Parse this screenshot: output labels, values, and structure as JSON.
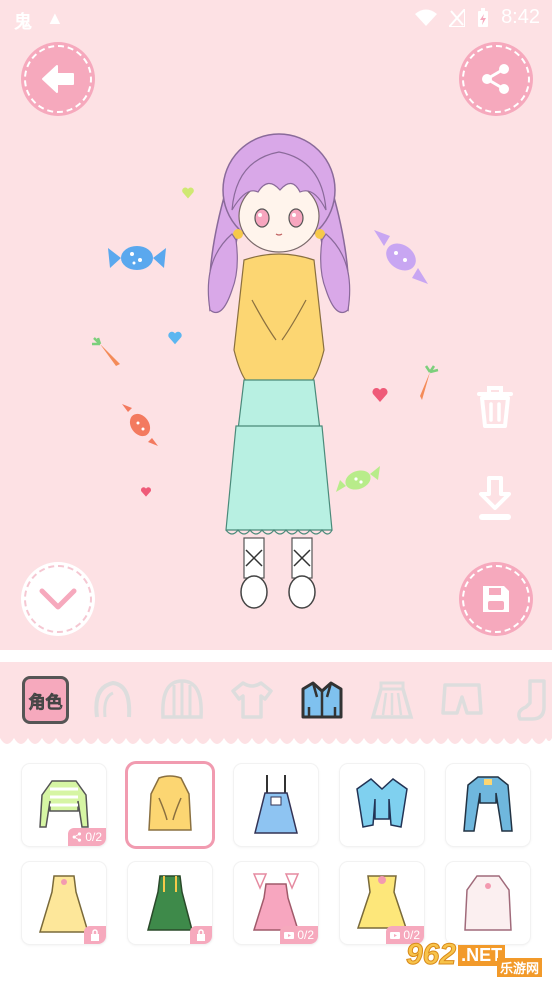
{
  "status_bar": {
    "time": "8:42",
    "left_glyphs": [
      "鬼",
      "▲"
    ]
  },
  "toolbar": {
    "back_icon": "arrow-left-icon",
    "share_icon": "share-icon",
    "delete_icon": "trash-icon",
    "download_icon": "download-icon",
    "collapse_icon": "chevron-down-icon",
    "save_icon": "floppy-disk-icon"
  },
  "categories": {
    "role_label": "角色",
    "items": [
      "hair-back",
      "hair-front",
      "shirt",
      "jacket",
      "skirt",
      "shorts",
      "socks"
    ],
    "selected": "jacket"
  },
  "items": [
    {
      "name": "striped-crop-top",
      "badge": "0/2",
      "badge_type": "share"
    },
    {
      "name": "yellow-sweater",
      "selected": true
    },
    {
      "name": "blue-overall-dress"
    },
    {
      "name": "blue-jacket"
    },
    {
      "name": "blue-jacket-2"
    },
    {
      "name": "yellow-bow-dress",
      "badge_type": "lock"
    },
    {
      "name": "green-dress",
      "badge_type": "lock"
    },
    {
      "name": "pink-bunny-dress",
      "badge": "0/2",
      "badge_type": "video"
    },
    {
      "name": "yellow-flower-dress",
      "badge": "0/2",
      "badge_type": "video"
    },
    {
      "name": "white-pink-dress"
    }
  ],
  "watermark": {
    "main": "962",
    "suffix": ".NET",
    "sub": "乐游网"
  },
  "colors": {
    "background": "#fde1e4",
    "accent": "#f6a9bd",
    "hair": "#d9a8e8",
    "sweater": "#fcd672",
    "skirt": "#b8f0e2"
  }
}
